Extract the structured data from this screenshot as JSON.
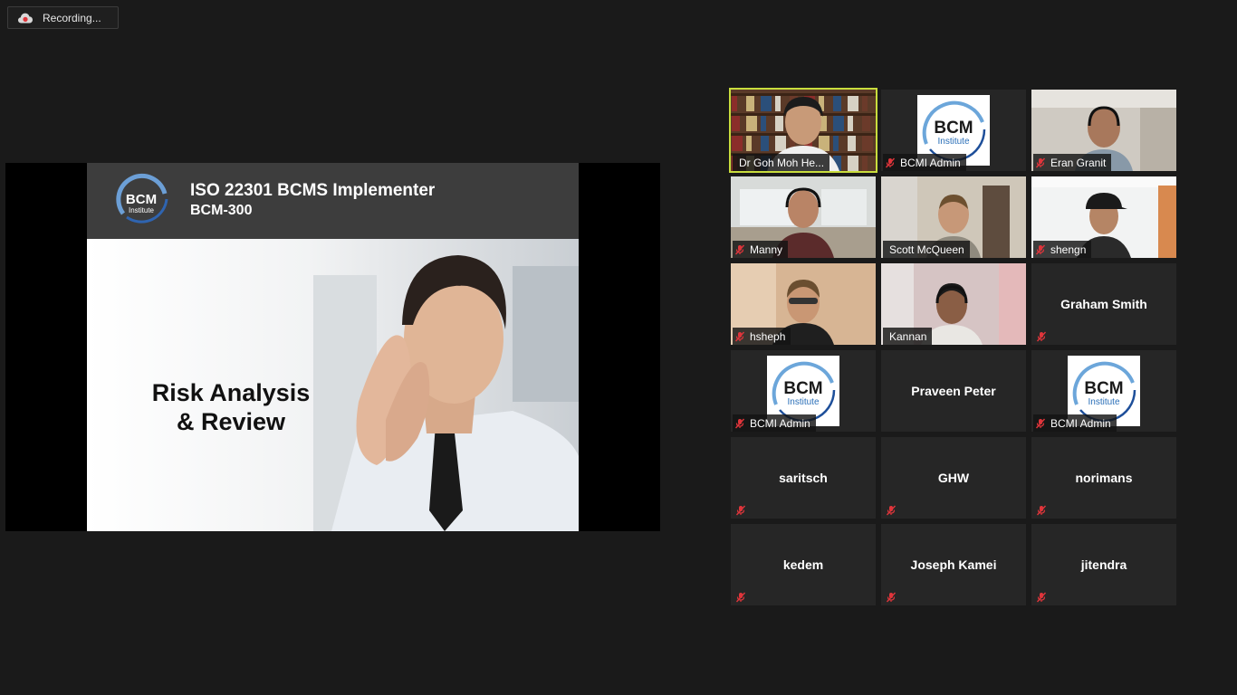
{
  "recording": {
    "label": "Recording..."
  },
  "share": {
    "title": "ISO 22301 BCMS Implementer",
    "code": "BCM-300",
    "logo_main": "BCM",
    "logo_sub": "Institute",
    "heading_line1": "Risk Analysis",
    "heading_line2": "& Review"
  },
  "participants": [
    {
      "name": "Dr Goh Moh He...",
      "type": "video",
      "active": true,
      "muted": false
    },
    {
      "name": "BCMI Admin",
      "type": "logo",
      "muted": true,
      "logo_main": "BCM",
      "logo_sub": "Institute"
    },
    {
      "name": "Eran Granit",
      "type": "video",
      "muted": true
    },
    {
      "name": "Manny",
      "type": "video",
      "muted": true
    },
    {
      "name": "Scott McQueen",
      "type": "video",
      "muted": false
    },
    {
      "name": "shengn",
      "type": "video",
      "muted": true
    },
    {
      "name": "hsheph",
      "type": "video",
      "muted": true
    },
    {
      "name": "Kannan",
      "type": "video",
      "muted": false
    },
    {
      "name": "Graham Smith",
      "type": "name",
      "muted": true
    },
    {
      "name": "BCMI Admin",
      "type": "logo",
      "muted": true,
      "logo_main": "BCM",
      "logo_sub": "Institute"
    },
    {
      "name": "Praveen Peter",
      "type": "name",
      "muted": false
    },
    {
      "name": "BCMI Admin",
      "type": "logo",
      "muted": true,
      "logo_main": "BCM",
      "logo_sub": "Institute"
    },
    {
      "name": "saritsch",
      "type": "name",
      "muted": true
    },
    {
      "name": "GHW",
      "type": "name",
      "muted": true
    },
    {
      "name": "norimans",
      "type": "name",
      "muted": true
    },
    {
      "name": "kedem",
      "type": "name",
      "muted": true
    },
    {
      "name": "Joseph Kamei",
      "type": "name",
      "muted": true
    },
    {
      "name": "jitendra",
      "type": "name",
      "muted": true
    }
  ],
  "colors": {
    "active_border": "#c9dd3d",
    "mute": "#e0353b",
    "record": "#e0353b"
  }
}
